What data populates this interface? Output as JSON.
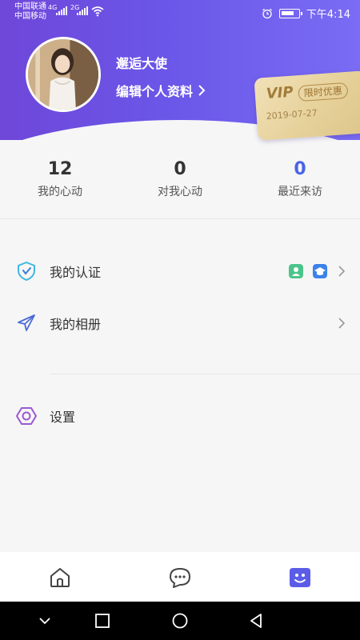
{
  "status_bar": {
    "carrier1": "中国联通",
    "carrier2": "中国移动",
    "net1": "4G",
    "net2": "2G",
    "time": "下午4:14"
  },
  "profile": {
    "nickname": "邂逅大使",
    "edit_label": "编辑个人资料"
  },
  "vip": {
    "title": "VIP",
    "badge": "限时优惠",
    "date": "2019-07-27"
  },
  "stats": [
    {
      "value": "12",
      "label": "我的心动"
    },
    {
      "value": "0",
      "label": "对我心动"
    },
    {
      "value": "0",
      "label": "最近来访"
    }
  ],
  "menu": {
    "certification": "我的认证",
    "album": "我的相册",
    "settings": "设置"
  },
  "colors": {
    "header_start": "#6f47d9",
    "header_end": "#7a6cf4",
    "accent_blue": "#4a63e6",
    "accent_purple": "#5b5de8"
  },
  "icons": {
    "certification": "shield-check-icon",
    "album": "paper-plane-icon",
    "settings": "hexagon-icon",
    "nav_home": "home-icon",
    "nav_chat": "chat-icon",
    "nav_me": "smile-icon"
  }
}
